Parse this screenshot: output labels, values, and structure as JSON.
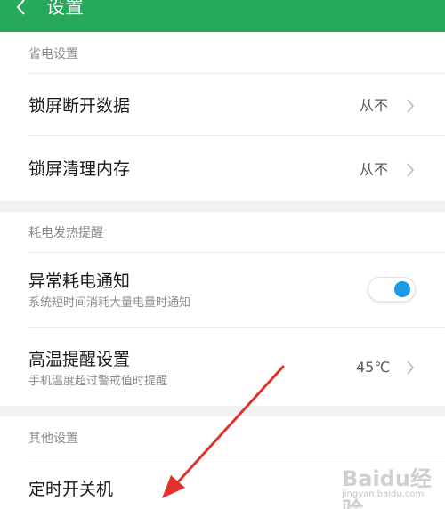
{
  "header": {
    "title": "设置"
  },
  "sections": [
    {
      "header": "省电设置",
      "rows": [
        {
          "title": "锁屏断开数据",
          "value": "从不"
        },
        {
          "title": "锁屏清理内存",
          "value": "从不"
        }
      ]
    },
    {
      "header": "耗电发热提醒",
      "rows": [
        {
          "title": "异常耗电通知",
          "subtitle": "系统短时间消耗大量电量时通知",
          "toggle_on": true
        },
        {
          "title": "高温提醒设置",
          "subtitle": "手机温度超过警戒值时提醒",
          "value": "45℃"
        }
      ]
    },
    {
      "header": "其他设置",
      "rows": [
        {
          "title": "定时开关机"
        }
      ]
    }
  ],
  "watermark": {
    "logo": "Baidu经验",
    "sub": "jingyan.baidu.com"
  },
  "annotation": {
    "color": "#e0322b"
  },
  "colors": {
    "topbar": "#27a95c",
    "toggle_knob": "#1b9be6"
  }
}
